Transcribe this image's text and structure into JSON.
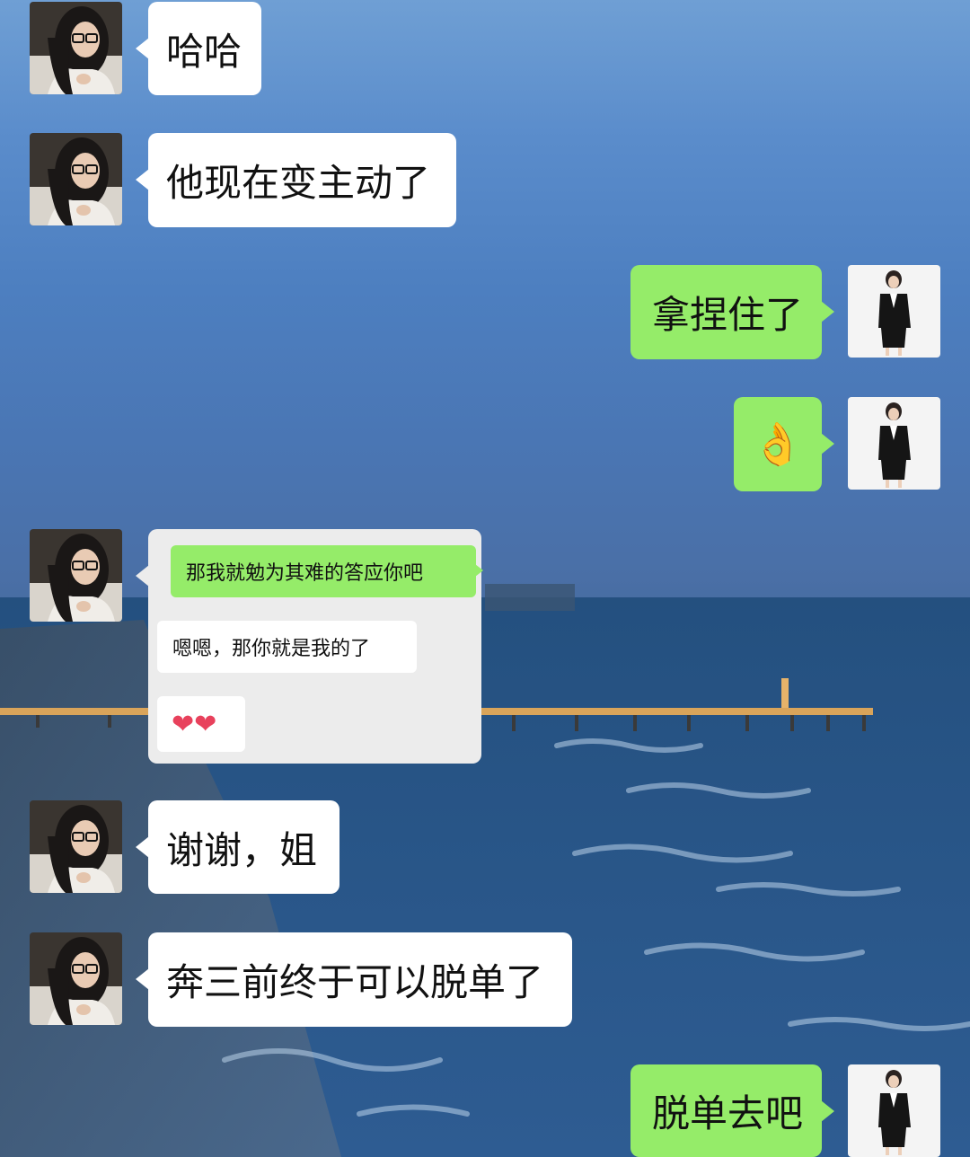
{
  "messages": [
    {
      "sender": "other",
      "text": "哈哈"
    },
    {
      "sender": "other",
      "text": "他现在变主动了"
    },
    {
      "sender": "self",
      "text": "拿捏住了"
    },
    {
      "sender": "self",
      "text": "👌"
    },
    {
      "sender": "other",
      "type": "screenshot",
      "inner": [
        {
          "sender": "self",
          "text": "那我就勉为其难的答应你吧"
        },
        {
          "sender": "other",
          "text": "嗯嗯，那你就是我的了"
        },
        {
          "sender": "other",
          "text": "❤❤"
        }
      ]
    },
    {
      "sender": "other",
      "text": "谢谢，姐"
    },
    {
      "sender": "other",
      "text": "奔三前终于可以脱单了"
    },
    {
      "sender": "self",
      "text": "脱单去吧"
    }
  ],
  "colors": {
    "self_bubble": "#95ec69",
    "other_bubble": "#ffffff",
    "heart": "#e8415c"
  },
  "icons": {
    "other_avatar": "woman-with-glasses-avatar",
    "self_avatar": "woman-in-suit-avatar"
  }
}
